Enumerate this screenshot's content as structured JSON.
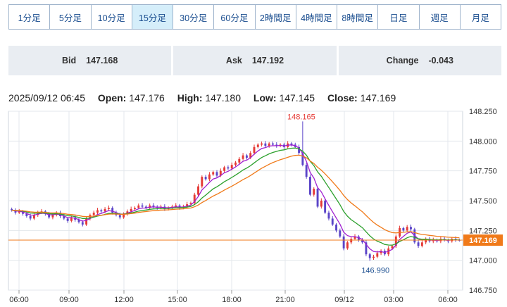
{
  "tabs": [
    {
      "label": "1分足",
      "active": false
    },
    {
      "label": "5分足",
      "active": false
    },
    {
      "label": "10分足",
      "active": false
    },
    {
      "label": "15分足",
      "active": true
    },
    {
      "label": "30分足",
      "active": false
    },
    {
      "label": "60分足",
      "active": false
    },
    {
      "label": "2時間足",
      "active": false
    },
    {
      "label": "4時間足",
      "active": false
    },
    {
      "label": "8時間足",
      "active": false
    },
    {
      "label": "日足",
      "active": false
    },
    {
      "label": "週足",
      "active": false
    },
    {
      "label": "月足",
      "active": false
    }
  ],
  "quotes": {
    "bid_label": "Bid",
    "bid_value": "147.168",
    "ask_label": "Ask",
    "ask_value": "147.192",
    "change_label": "Change",
    "change_value": "-0.043"
  },
  "ohlc": {
    "datetime": "2025/09/12 06:45",
    "open_label": "Open:",
    "open_value": "147.176",
    "high_label": "High:",
    "high_value": "147.180",
    "low_label": "Low:",
    "low_value": "147.145",
    "close_label": "Close:",
    "close_value": "147.169"
  },
  "chart_data": {
    "type": "candlestick",
    "y_ticks": [
      "148.250",
      "148.000",
      "147.750",
      "147.500",
      "147.250",
      "147.000",
      "146.750"
    ],
    "ylim": [
      146.75,
      148.25
    ],
    "x_ticks": [
      "06:00",
      "09:00",
      "12:00",
      "15:00",
      "18:00",
      "21:00",
      "09/12",
      "03:00",
      "06:00"
    ],
    "current_price": "147.169",
    "current_price_value": 147.169,
    "annotations": [
      {
        "text": "148.165",
        "value": 148.165,
        "kind": "high"
      },
      {
        "text": "146.990",
        "value": 146.99,
        "kind": "low"
      }
    ],
    "colors": {
      "up": "#e53935",
      "down": "#5b45c8",
      "ma_short": "#a020d0",
      "ma_mid": "#2ca02c",
      "ma_long": "#f07a1a",
      "price_line": "#f07a1a",
      "price_tag": "#f07a1a"
    },
    "closes": [
      147.42,
      147.4,
      147.41,
      147.39,
      147.37,
      147.35,
      147.38,
      147.4,
      147.41,
      147.39,
      147.36,
      147.38,
      147.4,
      147.37,
      147.35,
      147.33,
      147.36,
      147.34,
      147.32,
      147.3,
      147.35,
      147.38,
      147.4,
      147.42,
      147.41,
      147.43,
      147.44,
      147.4,
      147.38,
      147.36,
      147.39,
      147.41,
      147.43,
      147.44,
      147.46,
      147.45,
      147.44,
      147.46,
      147.45,
      147.44,
      147.45,
      147.43,
      147.44,
      147.45,
      147.46,
      147.44,
      147.45,
      147.47,
      147.48,
      147.55,
      147.62,
      147.7,
      147.68,
      147.72,
      147.74,
      147.71,
      147.75,
      147.78,
      147.77,
      147.8,
      147.82,
      147.85,
      147.88,
      147.86,
      147.9,
      147.95,
      147.97,
      147.98,
      147.96,
      147.98,
      147.97,
      147.96,
      147.97,
      147.95,
      147.98,
      147.97,
      147.95,
      147.9,
      147.8,
      147.7,
      147.55,
      147.6,
      147.45,
      147.5,
      147.4,
      147.35,
      147.3,
      147.25,
      147.2,
      147.1,
      147.15,
      147.18,
      147.2,
      147.17,
      147.15,
      147.05,
      147.02,
      147.03,
      147.06,
      147.08,
      147.05,
      147.1,
      147.12,
      147.2,
      147.27,
      147.25,
      147.28,
      147.26,
      147.15,
      147.12,
      147.15,
      147.18,
      147.16,
      147.17,
      147.16,
      147.18,
      147.17,
      147.16,
      147.18,
      147.17,
      147.169
    ]
  }
}
